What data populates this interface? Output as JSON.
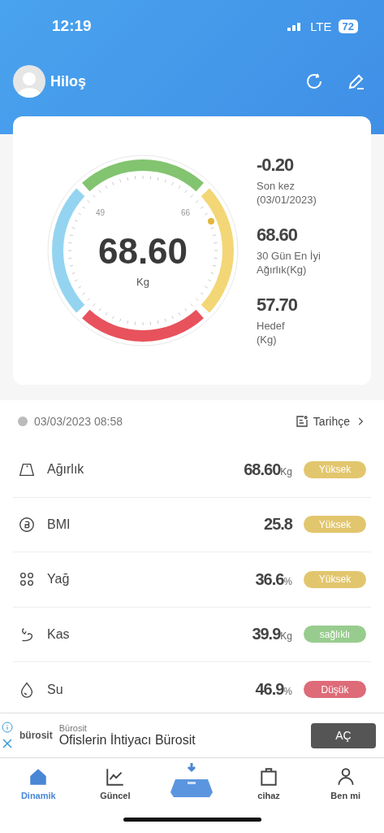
{
  "status_bar": {
    "time": "12:19",
    "network": "LTE",
    "battery": "72"
  },
  "profile": {
    "name": "Hiloş"
  },
  "gauge": {
    "value": "68.60",
    "unit": "Kg",
    "low_mark": "49",
    "high_mark": "66"
  },
  "stats": [
    {
      "value": "-0.20",
      "label": "Son kez\n(03/01/2023)"
    },
    {
      "value": "68.60",
      "label": "30 Gün En İyi\nAğırlık(Kg)"
    },
    {
      "value": "57.70",
      "label": "Hedef\n(Kg)"
    }
  ],
  "measurement": {
    "datetime": "03/03/2023 08:58",
    "history_link": "Tarihçe"
  },
  "metrics": [
    {
      "kind": "weight",
      "name": "Ağırlık",
      "value": "68.60",
      "unit": "Kg",
      "status": "Yüksek",
      "color": "#e2c66e"
    },
    {
      "kind": "bmi",
      "name": "BMI",
      "value": "25.8",
      "status": "Yüksek",
      "color": "#e2c66e"
    },
    {
      "kind": "fat",
      "name": "Yağ",
      "value": "36.6",
      "unit": "%",
      "status": "Yüksek",
      "color": "#e2c66e"
    },
    {
      "kind": "muscle",
      "name": "Kas",
      "value": "39.9",
      "unit": "Kg",
      "status": "sağlıklı",
      "color": "#98cc8e"
    },
    {
      "kind": "water",
      "name": "Su",
      "value": "46.9",
      "unit": "%",
      "status": "Düşük",
      "color": "#de6b78"
    }
  ],
  "ad": {
    "logo": "bürosit",
    "advertiser": "Bürosit",
    "headline": "Ofislerin İhtiyacı Bürosit",
    "button": "AÇ"
  },
  "tabs": [
    {
      "kind": "home",
      "label": "Dinamik",
      "selected": true
    },
    {
      "kind": "chart",
      "label": "Güncel",
      "selected": false
    },
    {
      "kind": "scale",
      "selected": false
    },
    {
      "kind": "bag",
      "label": "cihaz",
      "selected": false
    },
    {
      "kind": "person",
      "label": "Ben mi",
      "selected": false
    }
  ]
}
